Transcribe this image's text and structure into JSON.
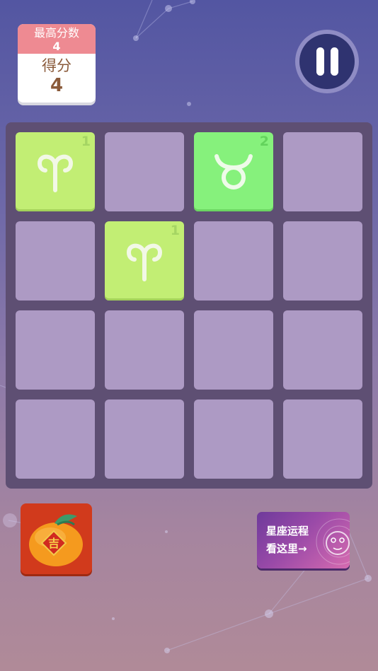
{
  "score": {
    "best_label": "最高分数",
    "best_value": "4",
    "current_label": "得分",
    "current_value": "4"
  },
  "board": {
    "tiles": [
      {
        "row": 0,
        "col": 0,
        "sign": "aries",
        "level": "1"
      },
      {
        "row": 0,
        "col": 2,
        "sign": "taurus",
        "level": "2"
      },
      {
        "row": 1,
        "col": 1,
        "sign": "aries",
        "level": "1"
      }
    ]
  },
  "orange": {
    "charm_text": "吉"
  },
  "horoscope": {
    "line1": "星座运程",
    "line2": "看这里→"
  },
  "colors": {
    "aries_tile": "#c2ee74",
    "taurus_tile": "#86f17c",
    "empty_tile": "#ad9ac4",
    "board_bg": "#5e4f73"
  },
  "icons": {
    "pause": "pause-icon",
    "aries": "aries-icon",
    "taurus": "taurus-icon",
    "orange": "orange-icon"
  }
}
